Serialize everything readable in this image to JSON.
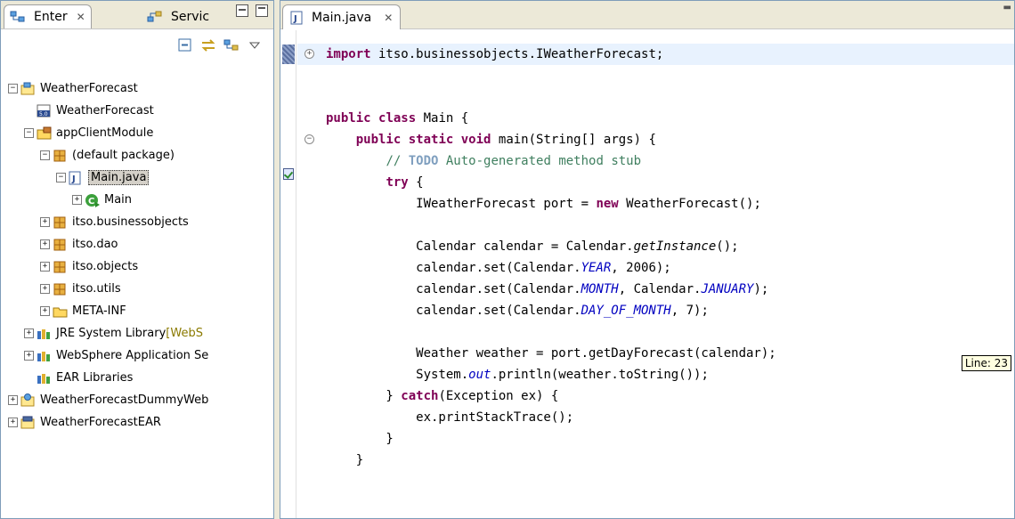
{
  "left_panel": {
    "tabs": [
      {
        "label": "Enter",
        "close": "✕"
      },
      {
        "label": "Servic"
      }
    ],
    "tree": [
      {
        "label": "WeatherForecast",
        "level": 0,
        "expander": "−",
        "icon": "project-icon"
      },
      {
        "label": "WeatherForecast",
        "level": 1,
        "expander": "",
        "icon": "deployment-descriptor-icon"
      },
      {
        "label": "appClientModule",
        "level": 1,
        "expander": "−",
        "icon": "source-folder-icon"
      },
      {
        "label": "(default package)",
        "level": 2,
        "expander": "−",
        "icon": "package-icon"
      },
      {
        "label": "Main.java",
        "level": 3,
        "expander": "−",
        "icon": "java-file-icon",
        "selected": true
      },
      {
        "label": "Main",
        "level": 4,
        "expander": "+",
        "icon": "class-icon"
      },
      {
        "label": "itso.businessobjects",
        "level": 2,
        "expander": "+",
        "icon": "package-icon"
      },
      {
        "label": "itso.dao",
        "level": 2,
        "expander": "+",
        "icon": "package-icon"
      },
      {
        "label": "itso.objects",
        "level": 2,
        "expander": "+",
        "icon": "package-icon"
      },
      {
        "label": "itso.utils",
        "level": 2,
        "expander": "+",
        "icon": "package-icon"
      },
      {
        "label": "META-INF",
        "level": 2,
        "expander": "+",
        "icon": "folder-icon"
      },
      {
        "label": "JRE System Library ",
        "extra": "[WebS",
        "level": 1,
        "expander": "+",
        "icon": "library-icon"
      },
      {
        "label": "WebSphere Application Se",
        "level": 1,
        "expander": "+",
        "icon": "library-icon"
      },
      {
        "label": "EAR Libraries",
        "level": 1,
        "expander": "",
        "icon": "library-icon"
      },
      {
        "label": "WeatherForecastDummyWeb",
        "level": 0,
        "expander": "+",
        "icon": "web-project-icon"
      },
      {
        "label": "WeatherForecastEAR",
        "level": 0,
        "expander": "+",
        "icon": "ear-project-icon"
      }
    ]
  },
  "editor": {
    "tab": {
      "label": "Main.java",
      "close": "✕"
    },
    "tooltip": "Line: 23",
    "lines": [
      "<span class=\"kw\">import</span> itso.businessobjects.IWeatherForecast;",
      "",
      "",
      "<span class=\"kw\">public</span> <span class=\"kw\">class</span> Main {",
      "    <span class=\"kw\">public</span> <span class=\"kw\">static</span> <span class=\"kw\">void</span> main(String[] args) {",
      "        <span class=\"cm\">// <span class=\"todo\">TODO</span> Auto-generated method stub</span>",
      "        <span class=\"kw\">try</span> {",
      "            IWeatherForecast port = <span class=\"kw\">new</span> WeatherForecast();",
      "",
      "            Calendar calendar = Calendar.<span class=\"mth\">getInstance</span>();",
      "            calendar.set(Calendar.<span class=\"fld\">YEAR</span>, 2006);",
      "            calendar.set(Calendar.<span class=\"fld\">MONTH</span>, Calendar.<span class=\"fld\">JANUARY</span>);",
      "            calendar.set(Calendar.<span class=\"fld\">DAY_OF_MONTH</span>, 7);",
      "",
      "            Weather weather = port.getDayForecast(calendar);",
      "            System.<span class=\"fld\">out</span>.println(weather.toString());",
      "        } <span class=\"kw\">catch</span>(Exception ex) {",
      "            ex.printStackTrace();",
      "        }",
      "    }"
    ],
    "plain_lines": [
      "import itso.businessobjects.IWeatherForecast;",
      "",
      "",
      "public class Main {",
      "    public static void main(String[] args) {",
      "        // TODO Auto-generated method stub",
      "        try {",
      "            IWeatherForecast port = new WeatherForecast();",
      "",
      "            Calendar calendar = Calendar.getInstance();",
      "            calendar.set(Calendar.YEAR, 2006);",
      "            calendar.set(Calendar.MONTH, Calendar.JANUARY);",
      "            calendar.set(Calendar.DAY_OF_MONTH, 7);",
      "",
      "            Weather weather = port.getDayForecast(calendar);",
      "            System.out.println(weather.toString());",
      "        } catch(Exception ex) {",
      "            ex.printStackTrace();",
      "        }",
      "    }"
    ]
  },
  "colors": {
    "keyword": "#7f0055",
    "comment": "#3f7f5f",
    "field": "#0000c0",
    "current_line": "#e8f2fe",
    "selection": "#d4d0c8"
  }
}
